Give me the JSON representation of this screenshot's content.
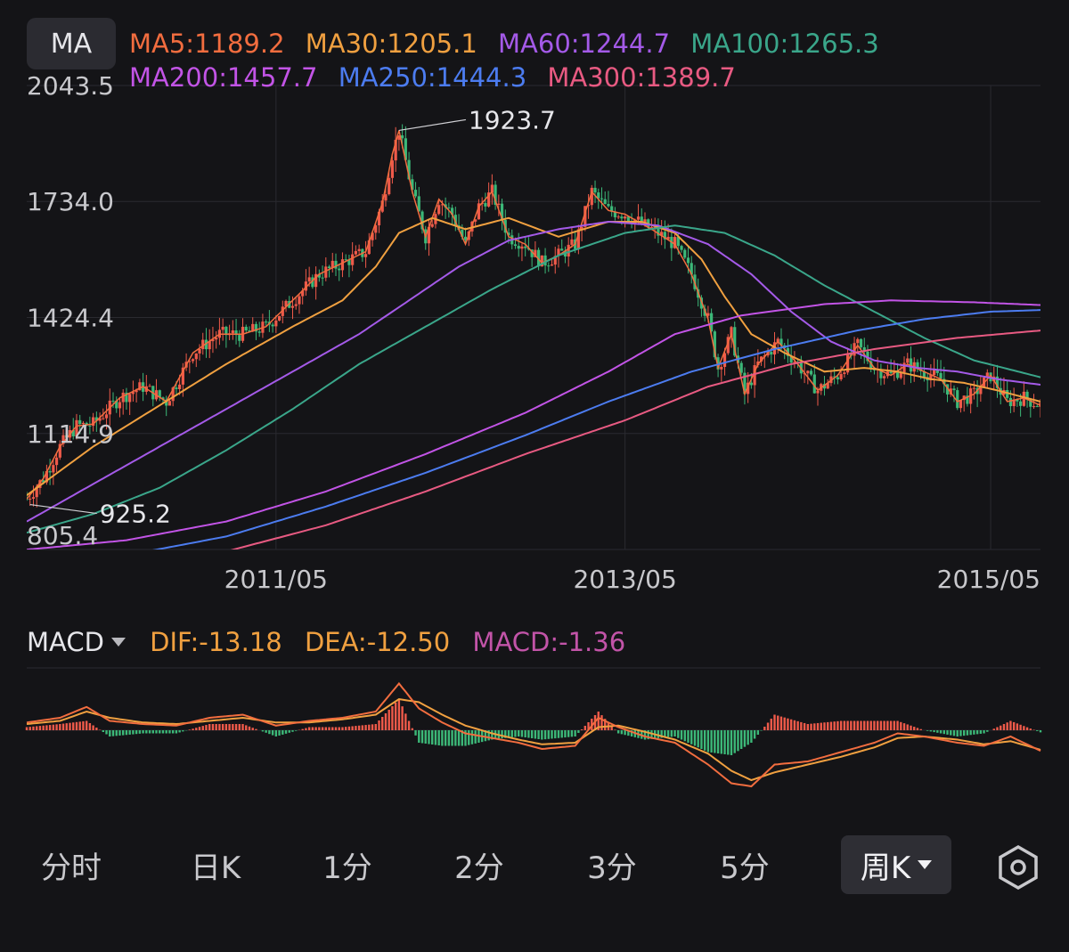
{
  "ma_button": "MA",
  "legend": [
    {
      "label": "MA5:1189.2",
      "color": "#f26d3f"
    },
    {
      "label": "MA30:1205.1",
      "color": "#f0a040"
    },
    {
      "label": "MA60:1244.7",
      "color": "#a45ae8"
    },
    {
      "label": "MA100:1265.3",
      "color": "#3aa68a"
    },
    {
      "label": "MA200:1457.7",
      "color": "#c254e6"
    },
    {
      "label": "MA250:1444.3",
      "color": "#4c7cf0"
    },
    {
      "label": "MA300:1389.7",
      "color": "#e85a82"
    }
  ],
  "macd_header": {
    "selector": "MACD",
    "dif": "DIF:-13.18",
    "dea": "DEA:-12.50",
    "macd": "MACD:-1.36",
    "dif_color": "#f0a040",
    "dea_color": "#f0a040",
    "macd_color": "#c254a8"
  },
  "colors": {
    "up": "#ef5a4a",
    "down": "#3cb878",
    "grid": "#2a2a30",
    "text": "#c8c8cc"
  },
  "chart_data": [
    {
      "type": "candlestick",
      "ylim": [
        805.4,
        2043.5
      ],
      "y_ticks": [
        {
          "value": 2043.5,
          "label": "2043.5"
        },
        {
          "value": 1734.0,
          "label": "1734.0"
        },
        {
          "value": 1424.4,
          "label": "1424.4"
        },
        {
          "value": 1114.9,
          "label": "1114.9"
        },
        {
          "value": 805.4,
          "label": "805.4"
        }
      ],
      "x_ticks": [
        {
          "week": 75,
          "label": "2011/05"
        },
        {
          "week": 180,
          "label": "2013/05"
        },
        {
          "week": 290,
          "label": "2015/05"
        }
      ],
      "weeks": 305,
      "annotations": [
        {
          "week": 112,
          "value": 1923.7,
          "label": "1923.7",
          "side": "right"
        },
        {
          "week": 1,
          "value": 925.2,
          "label": "925.2",
          "side": "right"
        }
      ],
      "price_path": [
        [
          0,
          940
        ],
        [
          5,
          995
        ],
        [
          10,
          1080
        ],
        [
          15,
          1135
        ],
        [
          20,
          1140
        ],
        [
          28,
          1210
        ],
        [
          35,
          1240
        ],
        [
          42,
          1200
        ],
        [
          50,
          1330
        ],
        [
          58,
          1380
        ],
        [
          65,
          1380
        ],
        [
          72,
          1400
        ],
        [
          80,
          1470
        ],
        [
          88,
          1540
        ],
        [
          95,
          1570
        ],
        [
          102,
          1600
        ],
        [
          107,
          1730
        ],
        [
          110,
          1860
        ],
        [
          112,
          1923.7
        ],
        [
          116,
          1760
        ],
        [
          120,
          1640
        ],
        [
          124,
          1740
        ],
        [
          128,
          1700
        ],
        [
          132,
          1620
        ],
        [
          136,
          1720
        ],
        [
          140,
          1760
        ],
        [
          145,
          1640
        ],
        [
          150,
          1620
        ],
        [
          155,
          1570
        ],
        [
          160,
          1590
        ],
        [
          165,
          1620
        ],
        [
          170,
          1760
        ],
        [
          175,
          1710
        ],
        [
          180,
          1700
        ],
        [
          188,
          1660
        ],
        [
          195,
          1620
        ],
        [
          200,
          1540
        ],
        [
          205,
          1420
        ],
        [
          208,
          1290
        ],
        [
          212,
          1380
        ],
        [
          216,
          1220
        ],
        [
          220,
          1300
        ],
        [
          226,
          1360
        ],
        [
          232,
          1300
        ],
        [
          238,
          1230
        ],
        [
          244,
          1270
        ],
        [
          250,
          1350
        ],
        [
          255,
          1290
        ],
        [
          260,
          1270
        ],
        [
          265,
          1300
        ],
        [
          270,
          1280
        ],
        [
          275,
          1260
        ],
        [
          280,
          1200
        ],
        [
          285,
          1220
        ],
        [
          290,
          1270
        ],
        [
          295,
          1200
        ],
        [
          300,
          1210
        ],
        [
          305,
          1190
        ]
      ],
      "series": [
        {
          "name": "MA5",
          "color": "#f26d3f",
          "values": []
        },
        {
          "name": "MA30",
          "color": "#f0a040",
          "points": [
            [
              0,
              950
            ],
            [
              20,
              1080
            ],
            [
              40,
              1190
            ],
            [
              60,
              1300
            ],
            [
              80,
              1400
            ],
            [
              95,
              1470
            ],
            [
              105,
              1560
            ],
            [
              112,
              1650
            ],
            [
              122,
              1690
            ],
            [
              132,
              1660
            ],
            [
              145,
              1690
            ],
            [
              160,
              1640
            ],
            [
              175,
              1680
            ],
            [
              185,
              1680
            ],
            [
              195,
              1650
            ],
            [
              203,
              1580
            ],
            [
              210,
              1480
            ],
            [
              218,
              1380
            ],
            [
              228,
              1330
            ],
            [
              240,
              1280
            ],
            [
              252,
              1290
            ],
            [
              262,
              1280
            ],
            [
              272,
              1260
            ],
            [
              282,
              1250
            ],
            [
              292,
              1230
            ],
            [
              305,
              1200
            ]
          ]
        },
        {
          "name": "MA60",
          "color": "#a45ae8",
          "points": [
            [
              0,
              880
            ],
            [
              20,
              980
            ],
            [
              40,
              1080
            ],
            [
              60,
              1180
            ],
            [
              80,
              1280
            ],
            [
              100,
              1380
            ],
            [
              115,
              1470
            ],
            [
              130,
              1560
            ],
            [
              145,
              1630
            ],
            [
              160,
              1660
            ],
            [
              175,
              1680
            ],
            [
              190,
              1670
            ],
            [
              205,
              1620
            ],
            [
              218,
              1540
            ],
            [
              230,
              1440
            ],
            [
              242,
              1360
            ],
            [
              255,
              1310
            ],
            [
              268,
              1290
            ],
            [
              280,
              1280
            ],
            [
              292,
              1260
            ],
            [
              305,
              1245
            ]
          ]
        },
        {
          "name": "MA100",
          "color": "#3aa68a",
          "points": [
            [
              0,
              850
            ],
            [
              20,
              900
            ],
            [
              40,
              970
            ],
            [
              60,
              1070
            ],
            [
              80,
              1180
            ],
            [
              100,
              1300
            ],
            [
              120,
              1400
            ],
            [
              140,
              1500
            ],
            [
              160,
              1590
            ],
            [
              180,
              1650
            ],
            [
              195,
              1670
            ],
            [
              210,
              1650
            ],
            [
              225,
              1590
            ],
            [
              240,
              1510
            ],
            [
              255,
              1440
            ],
            [
              270,
              1370
            ],
            [
              285,
              1310
            ],
            [
              305,
              1265
            ]
          ]
        },
        {
          "name": "MA200",
          "color": "#c254e6",
          "points": [
            [
              0,
              805
            ],
            [
              30,
              830
            ],
            [
              60,
              880
            ],
            [
              90,
              960
            ],
            [
              120,
              1060
            ],
            [
              150,
              1170
            ],
            [
              175,
              1280
            ],
            [
              195,
              1380
            ],
            [
              215,
              1430
            ],
            [
              240,
              1460
            ],
            [
              260,
              1470
            ],
            [
              285,
              1465
            ],
            [
              305,
              1457.7
            ]
          ]
        },
        {
          "name": "MA250",
          "color": "#4c7cf0",
          "points": [
            [
              0,
              760
            ],
            [
              30,
              790
            ],
            [
              60,
              840
            ],
            [
              90,
              920
            ],
            [
              120,
              1010
            ],
            [
              150,
              1110
            ],
            [
              175,
              1200
            ],
            [
              200,
              1280
            ],
            [
              225,
              1340
            ],
            [
              250,
              1390
            ],
            [
              270,
              1420
            ],
            [
              290,
              1440
            ],
            [
              305,
              1444.3
            ]
          ]
        },
        {
          "name": "MA300",
          "color": "#e85a82",
          "points": [
            [
              0,
              730
            ],
            [
              30,
              760
            ],
            [
              60,
              800
            ],
            [
              90,
              870
            ],
            [
              120,
              960
            ],
            [
              150,
              1060
            ],
            [
              180,
              1150
            ],
            [
              205,
              1240
            ],
            [
              230,
              1300
            ],
            [
              255,
              1340
            ],
            [
              280,
              1370
            ],
            [
              305,
              1389.7
            ]
          ]
        }
      ]
    },
    {
      "type": "macd",
      "dif": [
        [
          0,
          5
        ],
        [
          10,
          8
        ],
        [
          18,
          15
        ],
        [
          25,
          6
        ],
        [
          35,
          4
        ],
        [
          45,
          3
        ],
        [
          55,
          8
        ],
        [
          65,
          10
        ],
        [
          75,
          3
        ],
        [
          85,
          6
        ],
        [
          95,
          8
        ],
        [
          105,
          12
        ],
        [
          112,
          30
        ],
        [
          118,
          14
        ],
        [
          125,
          5
        ],
        [
          132,
          -2
        ],
        [
          140,
          -5
        ],
        [
          148,
          -8
        ],
        [
          155,
          -12
        ],
        [
          165,
          -10
        ],
        [
          172,
          8
        ],
        [
          178,
          2
        ],
        [
          186,
          -4
        ],
        [
          195,
          -8
        ],
        [
          205,
          -22
        ],
        [
          212,
          -34
        ],
        [
          218,
          -36
        ],
        [
          225,
          -22
        ],
        [
          235,
          -20
        ],
        [
          245,
          -14
        ],
        [
          255,
          -8
        ],
        [
          262,
          -2
        ],
        [
          270,
          -4
        ],
        [
          280,
          -8
        ],
        [
          288,
          -10
        ],
        [
          296,
          -4
        ],
        [
          305,
          -13.18
        ]
      ],
      "dea": [
        [
          0,
          4
        ],
        [
          10,
          6
        ],
        [
          18,
          12
        ],
        [
          25,
          8
        ],
        [
          35,
          5
        ],
        [
          45,
          4
        ],
        [
          55,
          6
        ],
        [
          65,
          8
        ],
        [
          75,
          5
        ],
        [
          85,
          5
        ],
        [
          95,
          7
        ],
        [
          105,
          10
        ],
        [
          112,
          20
        ],
        [
          118,
          18
        ],
        [
          125,
          10
        ],
        [
          132,
          3
        ],
        [
          140,
          -2
        ],
        [
          148,
          -6
        ],
        [
          155,
          -9
        ],
        [
          165,
          -8
        ],
        [
          172,
          2
        ],
        [
          178,
          3
        ],
        [
          186,
          -1
        ],
        [
          195,
          -6
        ],
        [
          205,
          -15
        ],
        [
          212,
          -26
        ],
        [
          218,
          -32
        ],
        [
          225,
          -27
        ],
        [
          235,
          -22
        ],
        [
          245,
          -17
        ],
        [
          255,
          -11
        ],
        [
          262,
          -5
        ],
        [
          270,
          -4
        ],
        [
          280,
          -6
        ],
        [
          288,
          -9
        ],
        [
          296,
          -7
        ],
        [
          305,
          -12.5
        ]
      ],
      "ylim": [
        -40,
        40
      ]
    }
  ],
  "tabs": [
    {
      "label": "分时",
      "active": false
    },
    {
      "label": "日K",
      "active": false
    },
    {
      "label": "1分",
      "active": false
    },
    {
      "label": "2分",
      "active": false
    },
    {
      "label": "3分",
      "active": false
    },
    {
      "label": "5分",
      "active": false
    },
    {
      "label": "周K",
      "active": true
    }
  ],
  "settings_icon": "settings-icon"
}
